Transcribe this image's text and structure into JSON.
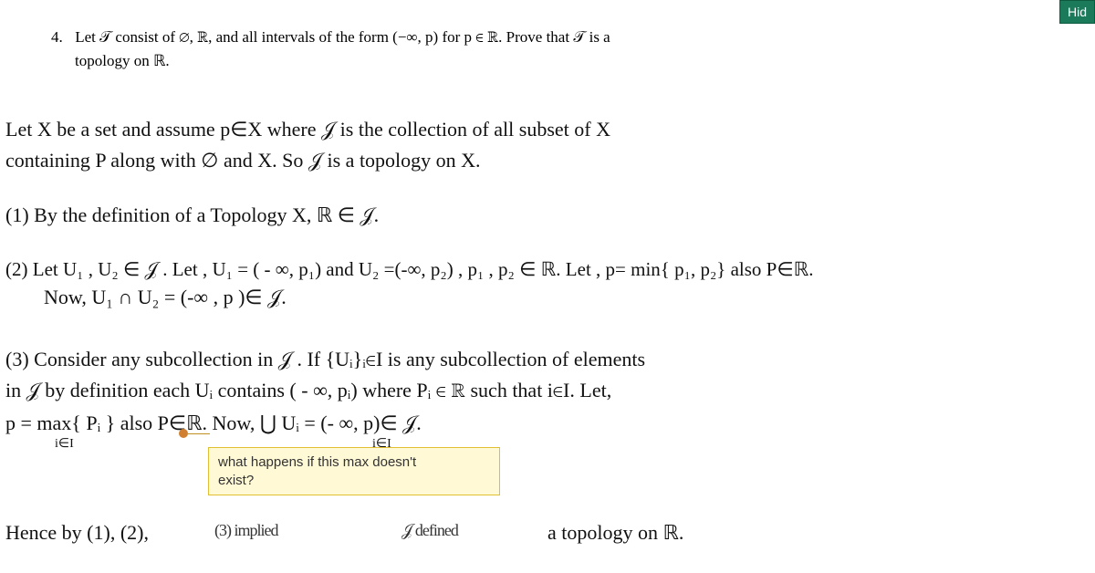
{
  "header": {
    "hide_button": "Hid"
  },
  "problem": {
    "number": "4.",
    "text_line1": "Let 𝒯 consist of ∅, ℝ, and all intervals of the form (−∞, p) for p ∈ ℝ. Prove that 𝒯 is a",
    "text_line2": "topology on ℝ."
  },
  "handwriting": {
    "l1": "Let  X  be  a  set  and assume  p∈X  where  𝒥  is  the  collection  of  all subset  of  X",
    "l2": "containing  P  along  with  ∅ and  X.  So  𝒥  is  a  topology on  X.",
    "l3": "(1) By  the  definition of  a  Topology   X, ℝ ∈  𝒥.",
    "l4": "(2)  Let  U₁ , U₂ ∈  𝒥 .  Let ,  U₁ = ( - ∞,  p₁) and   U₂ =(-∞, p₂) ,   p₁ , p₂ ∈ ℝ.   Let , p= min{ p₁, p₂}  also  P∈ℝ.",
    "l5": "Now,  U₁ ∩ U₂  = (-∞ , p )∈  𝒥.",
    "l6": "(3) Consider  any  subcollection  in   𝒥 . If  {Uᵢ}ᵢ∈I  is  any  subcollection of  elements",
    "l7": "in  𝒥  by  definition  each   Uᵢ  contains  ( - ∞, pᵢ)   where  Pᵢ ∈ ℝ  such  that  i∈I.  Let,",
    "l8a": "p = max{ Pᵢ }  also   P∈ℝ. Now,   ⋃ Uᵢ  = (- ∞, p)∈ 𝒥.",
    "l8sub1": "i∈I",
    "l8sub2": "i∈I",
    "l9a": "Hence  by  (1),  (2),",
    "l9b": "a  topology  on  ℝ.",
    "l9mid1": "(3)   implied",
    "l9mid2": "𝒥  defined"
  },
  "comment": {
    "line1": "what happens if this max doesn't",
    "line2": "exist?"
  }
}
